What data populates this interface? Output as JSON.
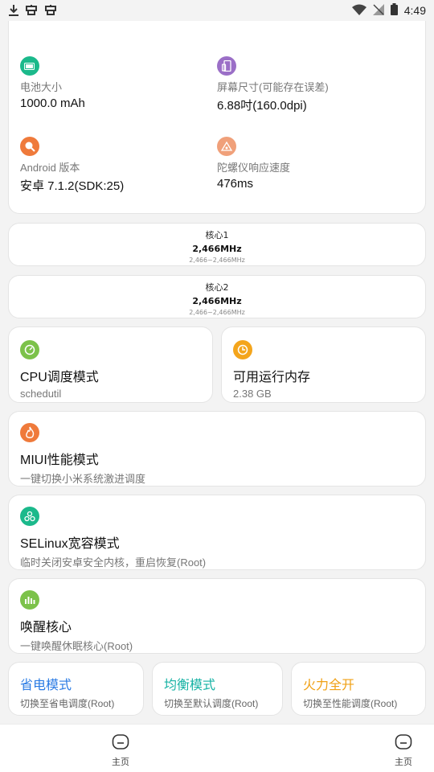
{
  "status_bar": {
    "time": "4:49",
    "left_icons": [
      "download-icon",
      "bug-icon",
      "bug-icon"
    ],
    "right_icons": [
      "wifi-icon",
      "no-signal-icon",
      "battery-icon"
    ]
  },
  "info_grid": [
    {
      "label": "电池大小",
      "value": "1000.0 mAh",
      "icon": "battery-icon",
      "color": "#1bb98b"
    },
    {
      "label": "屏幕尺寸(可能存在误差)",
      "value": "6.88吋(160.0dpi)",
      "icon": "phone-icon",
      "color": "#9b6fc7"
    },
    {
      "label": "Android 版本",
      "value": "安卓 7.1.2(SDK:25)",
      "icon": "android-icon",
      "color": "#ef7a3b"
    },
    {
      "label": "陀螺仪响应速度",
      "value": "476ms",
      "icon": "gyro-icon",
      "color": "#f0a07a"
    }
  ],
  "cores": [
    {
      "name": "核心1",
      "freq": "2,466MHz",
      "range": "2,466~2,466MHz"
    },
    {
      "name": "核心2",
      "freq": "2,466MHz",
      "range": "2,466~2,466MHz"
    }
  ],
  "cpu_governor": {
    "title": "CPU调度模式",
    "value": "schedutil",
    "icon": "cpu-gauge-icon",
    "color": "#7cc24a"
  },
  "available_ram": {
    "title": "可用运行内存",
    "value": "2.38 GB",
    "icon": "ram-clock-icon",
    "color": "#f4a51c"
  },
  "features": [
    {
      "title": "MIUI性能模式",
      "subtitle": "一键切换小米系统激进调度",
      "icon": "fire-icon",
      "color": "#ef7a3b"
    },
    {
      "title": "SELinux宽容模式",
      "subtitle": "临时关闭安卓安全内核，重启恢复(Root)",
      "icon": "security-nodes-icon",
      "color": "#1bb98b"
    },
    {
      "title": "唤醒核心",
      "subtitle": "一键唤醒休眠核心(Root)",
      "icon": "chart-bars-icon",
      "color": "#7cc24a"
    }
  ],
  "modes": [
    {
      "title": "省电模式",
      "subtitle": "切换至省电调度(Root)",
      "color": "#2a7be4"
    },
    {
      "title": "均衡模式",
      "subtitle": "切换至默认调度(Root)",
      "color": "#16b2a4"
    },
    {
      "title": "火力全开",
      "subtitle": "切换至性能调度(Root)",
      "color": "#f0a014"
    }
  ],
  "bottom_nav": [
    {
      "label": "主页",
      "icon": "home-icon"
    },
    {
      "label": "主页",
      "icon": "home-icon"
    }
  ]
}
